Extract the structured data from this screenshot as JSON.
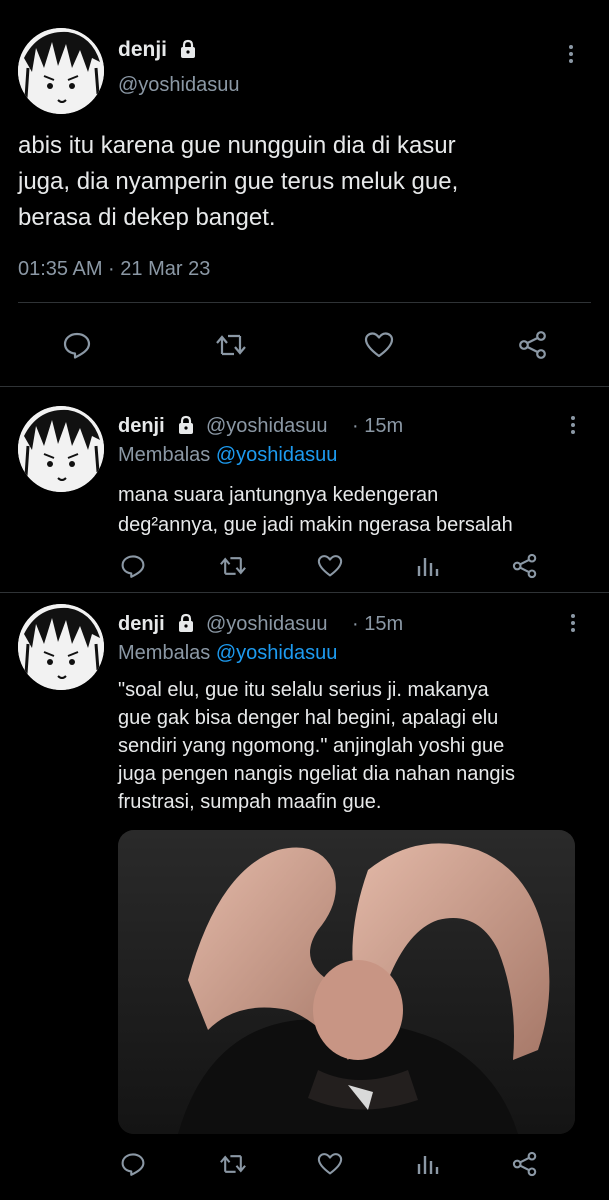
{
  "main_tweet": {
    "display_name": "denji",
    "handle": "@yoshidasuu",
    "text_lines": [
      "abis itu karena gue nungguin dia di kasur",
      "juga, dia nyamperin gue terus meluk gue,",
      "berasa di dekep banget."
    ],
    "timestamp": "01:35 AM · 21 Mar 23"
  },
  "replies": [
    {
      "display_name": "denji",
      "handle": "@yoshidasuu",
      "time": "· 15m",
      "replying_label": "Membalas",
      "replying_to": "@yoshidasuu",
      "text_lines": [
        "mana suara jantungnya kedengeran",
        "deg²annya, gue jadi makin ngerasa bersalah"
      ]
    },
    {
      "display_name": "denji",
      "handle": "@yoshidasuu",
      "time": "· 15m",
      "replying_label": "Membalas",
      "replying_to": "@yoshidasuu",
      "text_lines": [
        "\"soal elu, gue itu selalu serius ji. makanya",
        "gue gak bisa denger hal begini, apalagi elu",
        "sendiri yang ngomong.\" anjinglah yoshi gue",
        "juga pengen nangis ngeliat dia nahan nangis",
        "frustrasi, sumpah maafin gue."
      ]
    }
  ],
  "icons": {
    "lock": "lock-icon",
    "more": "more-vertical-icon",
    "reply": "reply-icon",
    "retweet": "retweet-icon",
    "like": "heart-icon",
    "share": "share-icon",
    "analytics": "analytics-icon"
  },
  "colors": {
    "background": "#000000",
    "text": "#e7e9ea",
    "muted": "#8b98a5",
    "link": "#1d9bf0",
    "divider": "#2f3336"
  }
}
